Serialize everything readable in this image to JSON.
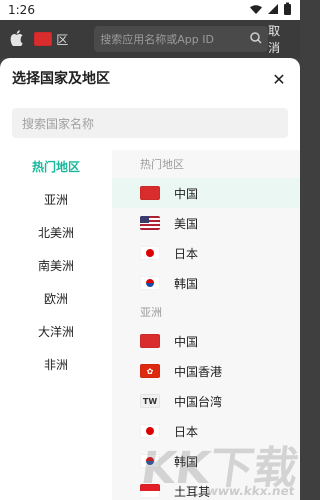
{
  "status": {
    "time": "1:26",
    "icons": [
      "wifi-icon",
      "cellular-icon",
      "battery-icon"
    ]
  },
  "background": {
    "apple_icon": "apple-icon",
    "region_code": "CN",
    "region_short": "区",
    "search_placeholder": "搜索应用名称或App ID",
    "cancel_label": "取消"
  },
  "sheet": {
    "title": "选择国家及地区",
    "close_icon": "close-icon",
    "search_placeholder": "搜索国家名称",
    "nav": [
      {
        "label": "热门地区"
      },
      {
        "label": "亚洲"
      },
      {
        "label": "北美洲"
      },
      {
        "label": "南美洲"
      },
      {
        "label": "欧洲"
      },
      {
        "label": "大洋洲"
      },
      {
        "label": "非洲"
      }
    ],
    "sections": [
      {
        "title": "热门地区",
        "rows": [
          {
            "name": "中国",
            "flag": "cn"
          },
          {
            "name": "美国",
            "flag": "us"
          },
          {
            "name": "日本",
            "flag": "jp"
          },
          {
            "name": "韩国",
            "flag": "kr"
          }
        ]
      },
      {
        "title": "亚洲",
        "rows": [
          {
            "name": "中国",
            "flag": "cn"
          },
          {
            "name": "中国香港",
            "flag": "hk"
          },
          {
            "name": "中国台湾",
            "flag": "tw",
            "flag_text": "TW"
          },
          {
            "name": "日本",
            "flag": "jp"
          },
          {
            "name": "韩国",
            "flag": "kr"
          },
          {
            "name": "土耳其",
            "flag": "sg"
          }
        ]
      }
    ],
    "watermark": {
      "big": "KK下载",
      "small": "www.kkx.net"
    }
  },
  "colors": {
    "accent": "#19b89b",
    "active_row_bg": "#eaf7f3",
    "right_pane_bg": "#f7f7f7"
  }
}
